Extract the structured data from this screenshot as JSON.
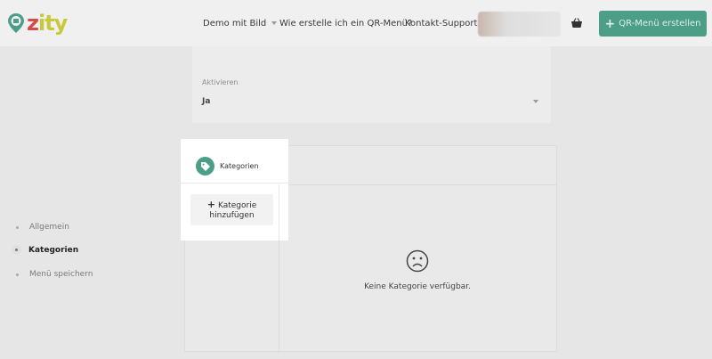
{
  "header": {
    "logo_text_a": "z",
    "logo_text_b": "ity",
    "nav_demo": "Demo mit Bild",
    "nav_howto": "Wie erstelle ich ein QR-Menü?",
    "nav_support": "Kontakt-Support",
    "cta_label": "QR-Menü erstellen",
    "accent_color": "#4d9e86"
  },
  "activate": {
    "label": "Aktivieren",
    "value": "Ja"
  },
  "steps": [
    {
      "label": "Allgemein",
      "active": false
    },
    {
      "label": "Kategorien",
      "active": true
    },
    {
      "label": "Menü speichern",
      "active": false
    }
  ],
  "categories": {
    "title": "Kategorien",
    "add_label_line1": "Kategorie",
    "add_label_line2": "hinzufügen",
    "empty_text": "Keine Kategorie verfügbar.",
    "icon": "tag-icon"
  }
}
